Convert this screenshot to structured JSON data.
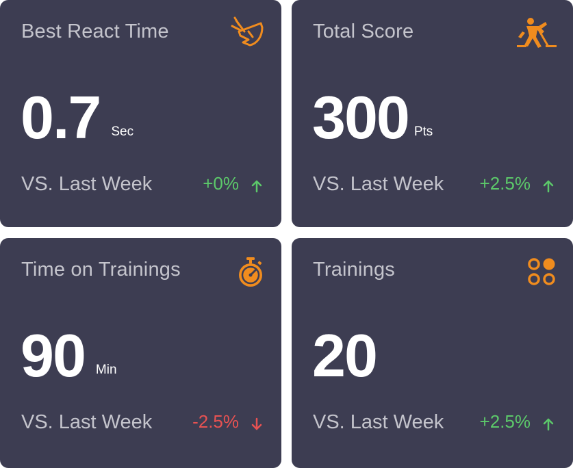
{
  "colors": {
    "card_bg": "#3d3d52",
    "accent_icon": "#f08c1e",
    "positive": "#5cc96a",
    "negative": "#e85252"
  },
  "cards": [
    {
      "title": "Best React Time",
      "icon": "stopwatch-speed-icon",
      "value": "0.7",
      "unit": "Sec",
      "compare_label": "VS. Last Week",
      "delta": "+0%",
      "trend": "up"
    },
    {
      "title": "Total Score",
      "icon": "hockey-player-icon",
      "value": "300",
      "unit": "Pts",
      "compare_label": "VS. Last Week",
      "delta": "+2.5%",
      "trend": "up"
    },
    {
      "title": "Time on Trainings",
      "icon": "timer-icon",
      "value": "90",
      "unit": "Min",
      "compare_label": "VS. Last Week",
      "delta": "-2.5%",
      "trend": "down"
    },
    {
      "title": "Trainings",
      "icon": "four-dots-icon",
      "value": "20",
      "unit": "",
      "compare_label": "VS. Last Week",
      "delta": "+2.5%",
      "trend": "up"
    }
  ]
}
